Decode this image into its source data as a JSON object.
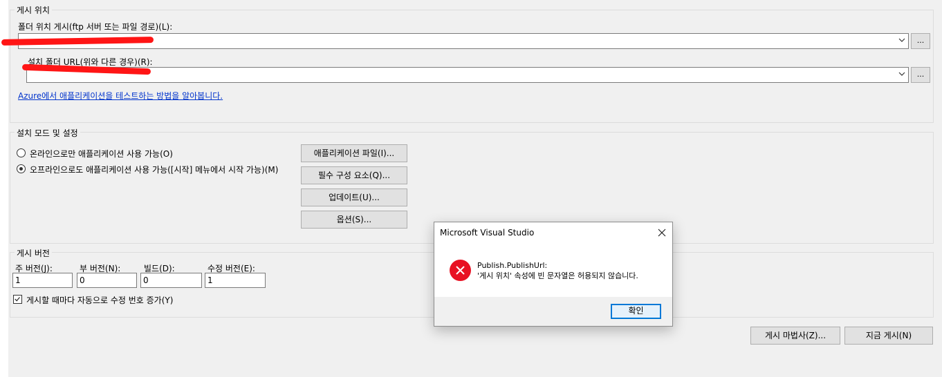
{
  "publish_location": {
    "group_title": "게시 위치",
    "folder_label": "폴더 위치 게시(ftp 서버 또는 파일 경로)(L):",
    "folder_value": "",
    "install_label": "설치 폴더 URL(위와 다른 경우)(R):",
    "install_value": "",
    "browse_label": "...",
    "azure_link": "Azure에서 애플리케이션을 테스트하는 방법을 알아봅니다."
  },
  "install_mode": {
    "group_title": "설치 모드 및 설정",
    "radio_online": "온라인으로만 애플리케이션 사용 가능(O)",
    "radio_offline": "오프라인으로도 애플리케이션 사용 가능([시작] 메뉴에서 시작 가능)(M)",
    "selected": "offline",
    "buttons": {
      "app_files": "애플리케이션 파일(I)...",
      "prerequisites": "필수 구성 요소(Q)...",
      "updates": "업데이트(U)...",
      "options": "옵션(S)..."
    }
  },
  "publish_version": {
    "group_title": "게시 버전",
    "major_label": "주 버전(J):",
    "minor_label": "부 버전(N):",
    "build_label": "빌드(D):",
    "revision_label": "수정 버전(E):",
    "major": "1",
    "minor": "0",
    "build": "0",
    "revision": "1",
    "auto_increment_label": "게시할 때마다 자동으로 수정 번호 증가(Y)",
    "auto_increment": true
  },
  "footer": {
    "wizard_button": "게시 마법사(Z)...",
    "publish_now_button": "지금 게시(N)"
  },
  "dialog": {
    "title": "Microsoft Visual Studio",
    "message_line1": "Publish.PublishUrl:",
    "message_line2": "'게시 위치' 속성에 빈 문자열은 허용되지 않습니다.",
    "ok_button": "확인",
    "icon": "error-icon",
    "icon_color": "#e81123"
  }
}
